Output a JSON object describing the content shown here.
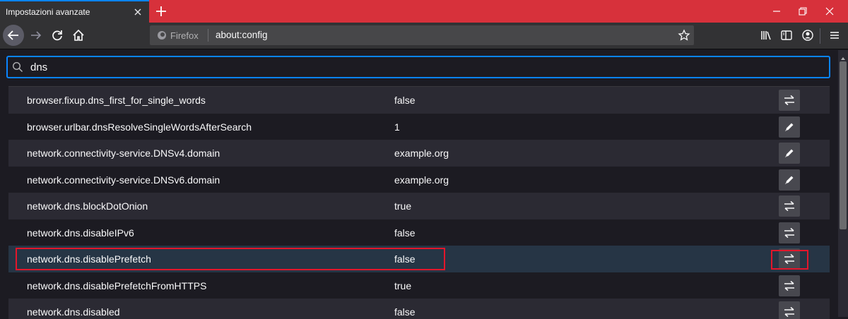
{
  "tab": {
    "title": "Impostazioni avanzate"
  },
  "colors": {
    "titlebar": "#d7313b",
    "accent": "#0a84ff",
    "highlight": "#e3162b"
  },
  "urlbar": {
    "identity": "Firefox",
    "url": "about:config"
  },
  "search": {
    "value": "dns"
  },
  "prefs": [
    {
      "name": "browser.fixup.dns_first_for_single_words",
      "value": "false",
      "action": "toggle-icon"
    },
    {
      "name": "browser.urlbar.dnsResolveSingleWordsAfterSearch",
      "value": "1",
      "action": "edit-pencil-icon"
    },
    {
      "name": "network.connectivity-service.DNSv4.domain",
      "value": "example.org",
      "action": "edit-pencil-icon"
    },
    {
      "name": "network.connectivity-service.DNSv6.domain",
      "value": "example.org",
      "action": "edit-pencil-icon"
    },
    {
      "name": "network.dns.blockDotOnion",
      "value": "true",
      "action": "toggle-icon"
    },
    {
      "name": "network.dns.disableIPv6",
      "value": "false",
      "action": "toggle-icon"
    },
    {
      "name": "network.dns.disablePrefetch",
      "value": "false",
      "action": "toggle-icon"
    },
    {
      "name": "network.dns.disablePrefetchFromHTTPS",
      "value": "true",
      "action": "toggle-icon"
    },
    {
      "name": "network.dns.disabled",
      "value": "false",
      "action": "toggle-icon"
    }
  ],
  "selected_pref": "network.dns.disablePrefetch"
}
